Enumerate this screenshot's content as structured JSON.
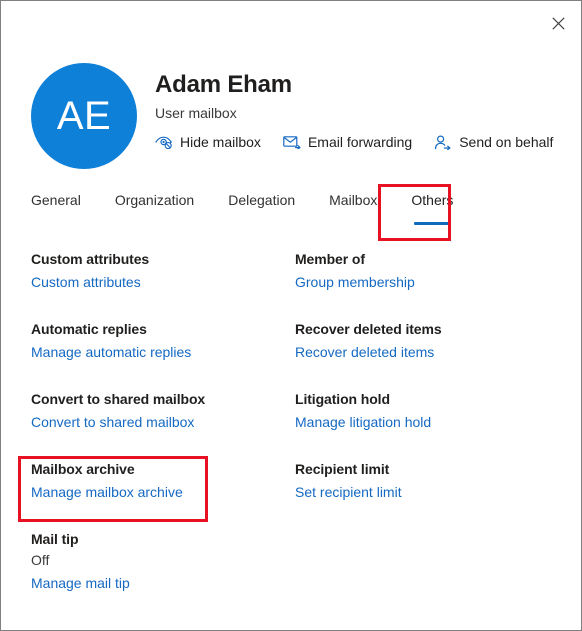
{
  "window": {
    "close_label": "Close",
    "close_icon": "close-icon",
    "border_color": "#808080"
  },
  "header": {
    "avatar": {
      "initials": "AE",
      "background_color": "#0F80D8",
      "text_color": "#FFFFFF"
    },
    "display_name": "Adam Eham",
    "mailbox_type": "User mailbox",
    "actions": [
      {
        "label": "Hide mailbox",
        "icon": "hide-eye-icon"
      },
      {
        "label": "Email forwarding",
        "icon": "envelope-forward-icon"
      },
      {
        "label": "Send on behalf",
        "icon": "person-arrow-icon"
      }
    ]
  },
  "tabs": {
    "items": [
      {
        "label": "General",
        "selected": false
      },
      {
        "label": "Organization",
        "selected": false
      },
      {
        "label": "Delegation",
        "selected": false
      },
      {
        "label": "Mailbox",
        "selected": false
      },
      {
        "label": "Others",
        "selected": true
      }
    ],
    "selected_underline_color": "#0F6CBD"
  },
  "settings": {
    "items": [
      {
        "title": "Custom attributes",
        "link": "Custom attributes",
        "value": null
      },
      {
        "title": "Member of",
        "link": "Group membership",
        "value": null
      },
      {
        "title": "Automatic replies",
        "link": "Manage automatic replies",
        "value": null
      },
      {
        "title": "Recover deleted items",
        "link": "Recover deleted items",
        "value": null
      },
      {
        "title": "Convert to shared mailbox",
        "link": "Convert to shared mailbox",
        "value": null
      },
      {
        "title": "Litigation hold",
        "link": "Manage litigation hold",
        "value": null
      },
      {
        "title": "Mailbox archive",
        "link": "Manage mailbox archive",
        "value": null
      },
      {
        "title": "Recipient limit",
        "link": "Set recipient limit",
        "value": null
      },
      {
        "title": "Mail tip",
        "link": "Manage mail tip",
        "value": "Off"
      }
    ],
    "link_color": "#1569C3"
  },
  "annotations": {
    "color": "#E81123",
    "boxes": [
      {
        "name": "others-tab-highlight",
        "target": "Others"
      },
      {
        "name": "mailbox-archive-highlight",
        "target": "Mailbox archive"
      }
    ]
  }
}
